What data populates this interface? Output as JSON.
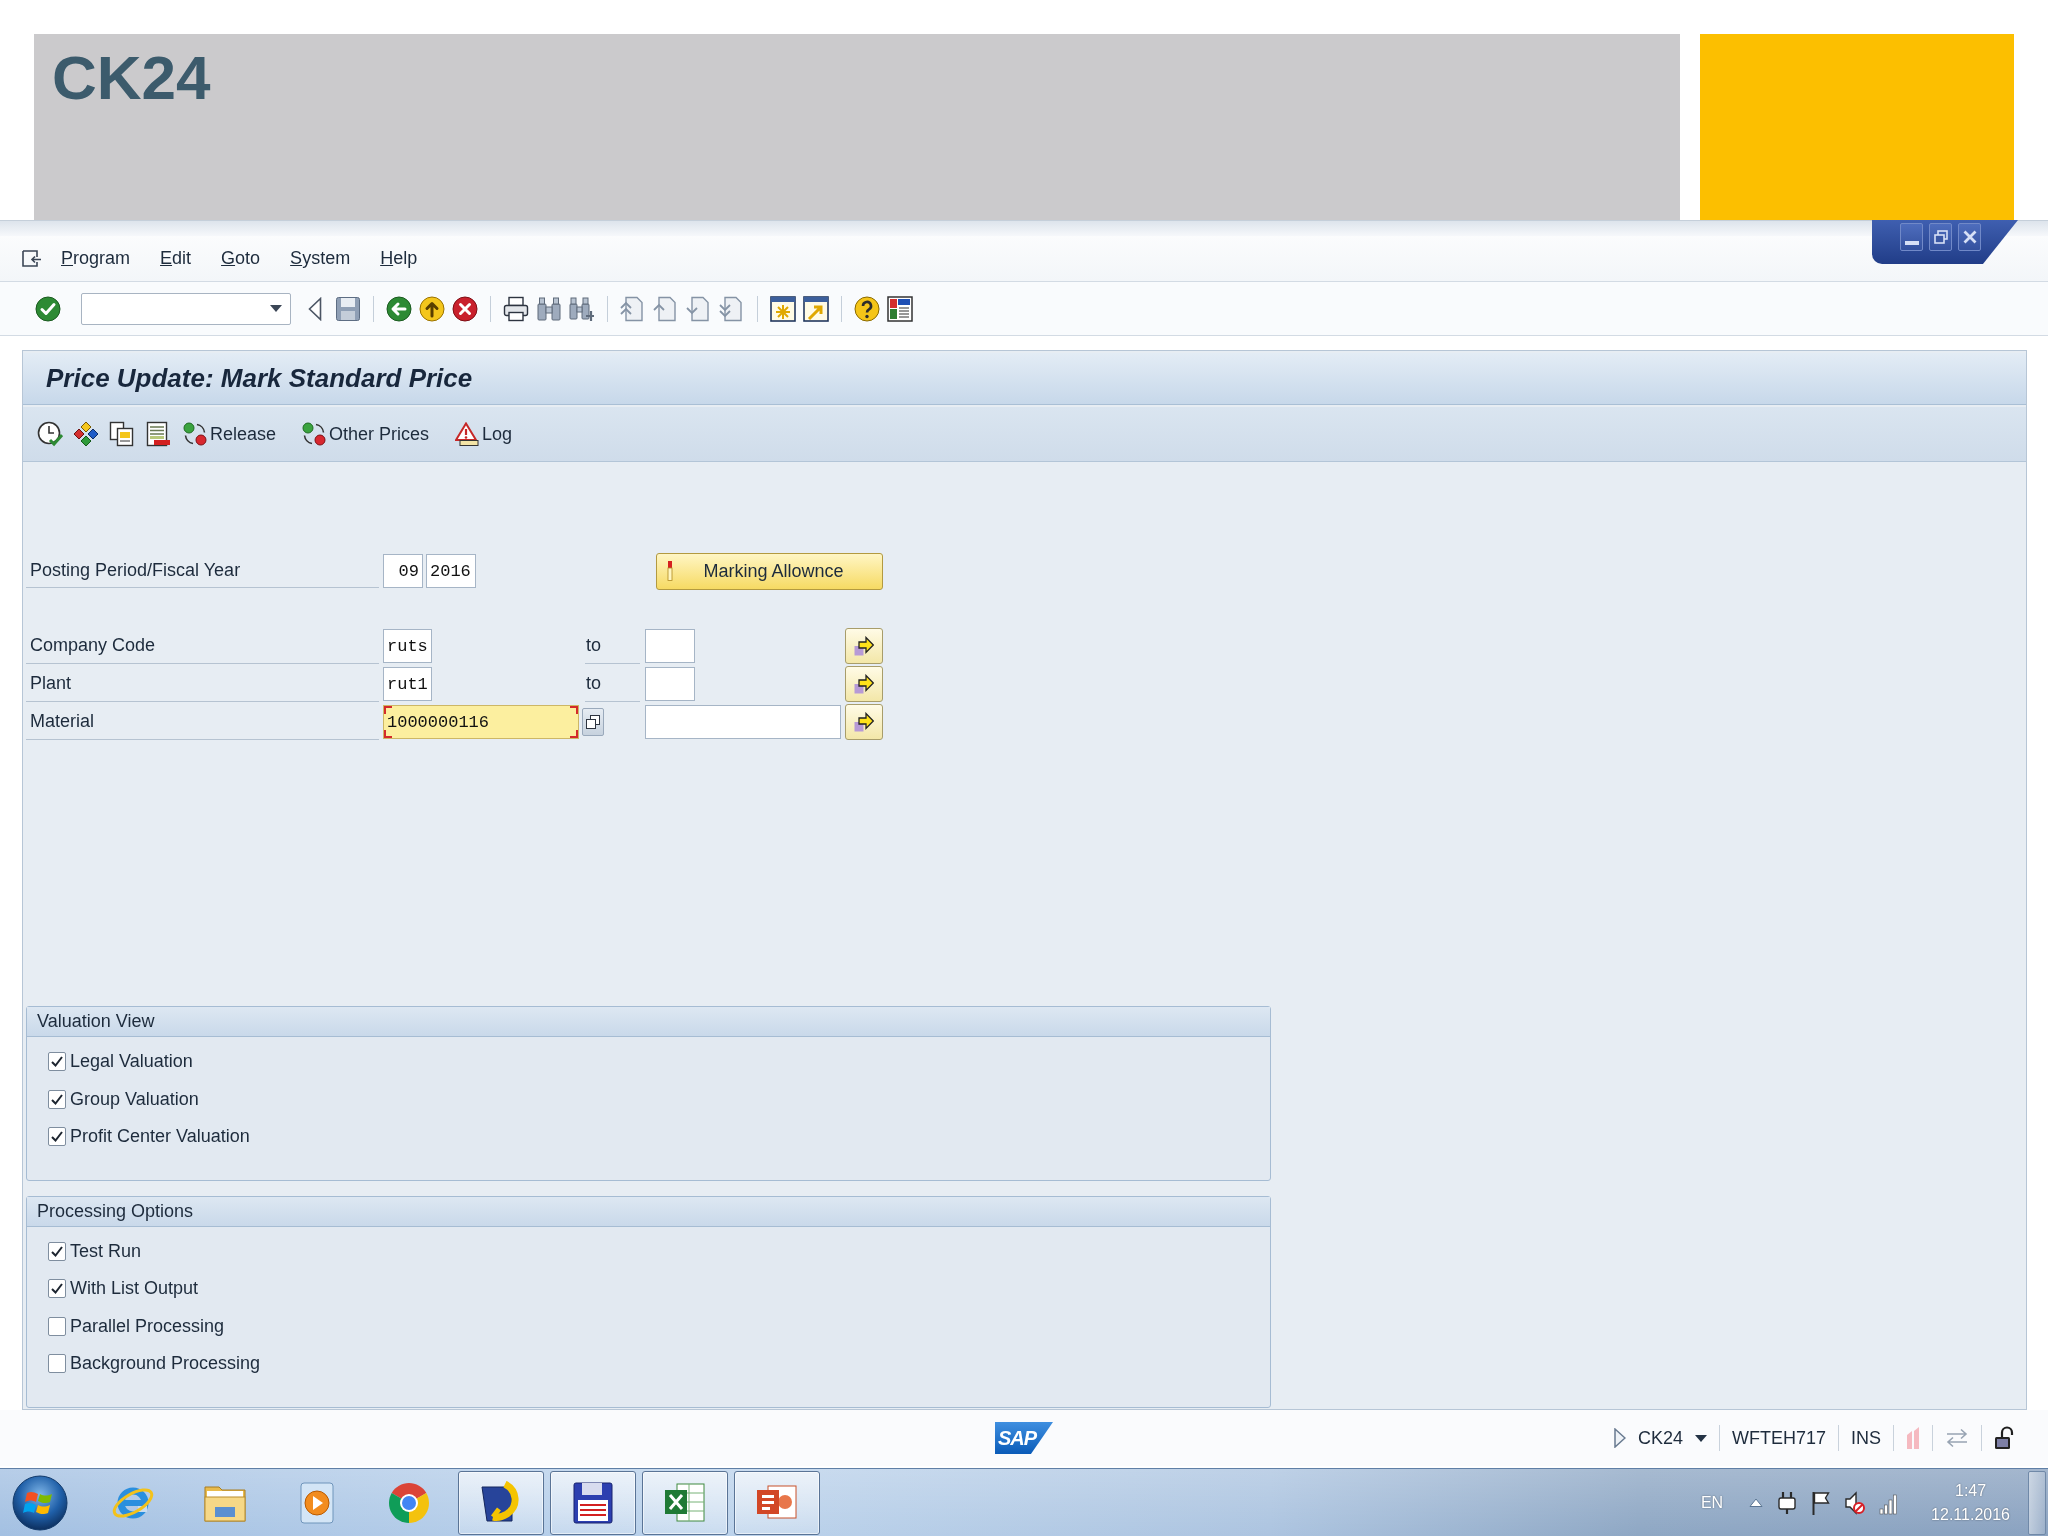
{
  "slide": {
    "title": "CK24"
  },
  "menu": [
    {
      "label": "Program"
    },
    {
      "label": "Edit"
    },
    {
      "label": "Goto"
    },
    {
      "label": "System"
    },
    {
      "label": "Help"
    }
  ],
  "screen": {
    "title": "Price Update: Mark Standard Price",
    "actions": [
      {
        "label": "Release"
      },
      {
        "label": "Other Prices"
      },
      {
        "label": "Log"
      }
    ]
  },
  "form": {
    "period": {
      "label": "Posting Period/Fiscal Year",
      "period": "09",
      "year": "2016"
    },
    "marking_button": "Marking Allownce",
    "selections": [
      {
        "label": "Company Code",
        "kind": "short",
        "from": "ruts",
        "to_label": "to",
        "focused": false
      },
      {
        "label": "Plant",
        "kind": "short",
        "from": "rut1",
        "to_label": "to",
        "focused": false
      },
      {
        "label": "Material",
        "kind": "long",
        "from": "1000000116",
        "focused": true
      }
    ]
  },
  "groups": [
    {
      "title": "Valuation View",
      "options": [
        {
          "label": "Legal Valuation",
          "checked": true
        },
        {
          "label": "Group Valuation",
          "checked": true
        },
        {
          "label": "Profit Center Valuation",
          "checked": true
        }
      ]
    },
    {
      "title": "Processing Options",
      "options": [
        {
          "label": "Test Run",
          "checked": true
        },
        {
          "label": "With List Output",
          "checked": true
        },
        {
          "label": "Parallel Processing",
          "checked": false
        },
        {
          "label": "Background Processing",
          "checked": false
        }
      ]
    }
  ],
  "status_bar": {
    "logo": "SAP",
    "transaction": "CK24",
    "server": "WFTEH717",
    "mode": "INS"
  },
  "taskbar": {
    "apps": [
      {
        "running": false
      },
      {
        "running": false
      },
      {
        "running": false
      },
      {
        "running": false
      },
      {
        "running": true
      },
      {
        "running": true
      },
      {
        "running": true
      },
      {
        "running": true
      }
    ],
    "language": "EN",
    "time": "1:47",
    "date": "12.11.2016"
  }
}
